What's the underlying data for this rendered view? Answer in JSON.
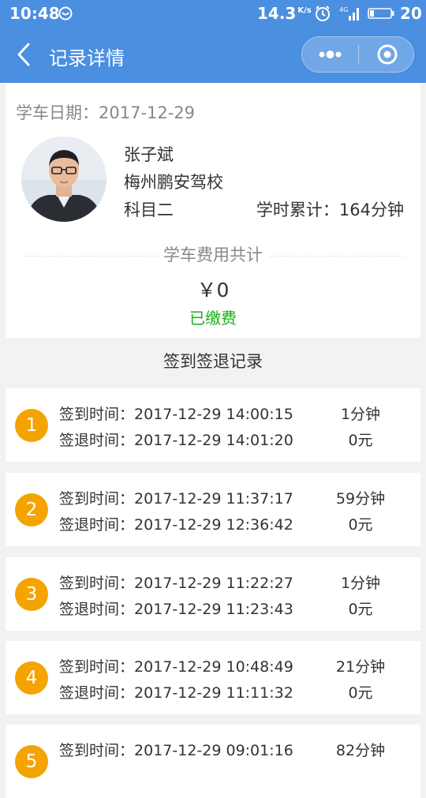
{
  "status_bar": {
    "time": "10:48",
    "speed": "14.3",
    "speed_unit": "K/s",
    "battery": "20"
  },
  "nav": {
    "title": "记录详情"
  },
  "colors": {
    "header": "#4a8fe0",
    "badge": "#f5a300",
    "paid": "#1aad19"
  },
  "info": {
    "date_label": "学车日期：",
    "date": "2017-12-29",
    "name": "张子斌",
    "school": "梅州鹏安驾校",
    "subject": "科目二",
    "hours_label": "学时累计：",
    "hours_value": "164分钟",
    "fee_label": "学车费用共计",
    "fee_amount": "￥0",
    "paid_status": "已缴费"
  },
  "records_title": "签到签退记录",
  "records": [
    {
      "index": "1",
      "checkin_label": "签到时间：",
      "checkin": "2017-12-29 14:00:15",
      "checkout_label": "签退时间：",
      "checkout": "2017-12-29 14:01:20",
      "duration": "1分钟",
      "fee": "0元"
    },
    {
      "index": "2",
      "checkin_label": "签到时间：",
      "checkin": "2017-12-29 11:37:17",
      "checkout_label": "签退时间：",
      "checkout": "2017-12-29 12:36:42",
      "duration": "59分钟",
      "fee": "0元"
    },
    {
      "index": "3",
      "checkin_label": "签到时间：",
      "checkin": "2017-12-29 11:22:27",
      "checkout_label": "签退时间：",
      "checkout": "2017-12-29 11:23:43",
      "duration": "1分钟",
      "fee": "0元"
    },
    {
      "index": "4",
      "checkin_label": "签到时间：",
      "checkin": "2017-12-29 10:48:49",
      "checkout_label": "签退时间：",
      "checkout": "2017-12-29 11:11:32",
      "duration": "21分钟",
      "fee": "0元"
    },
    {
      "index": "5",
      "checkin_label": "签到时间：",
      "checkin": "2017-12-29 09:01:16",
      "checkout_label": "",
      "checkout": "",
      "duration": "82分钟",
      "fee": ""
    }
  ]
}
